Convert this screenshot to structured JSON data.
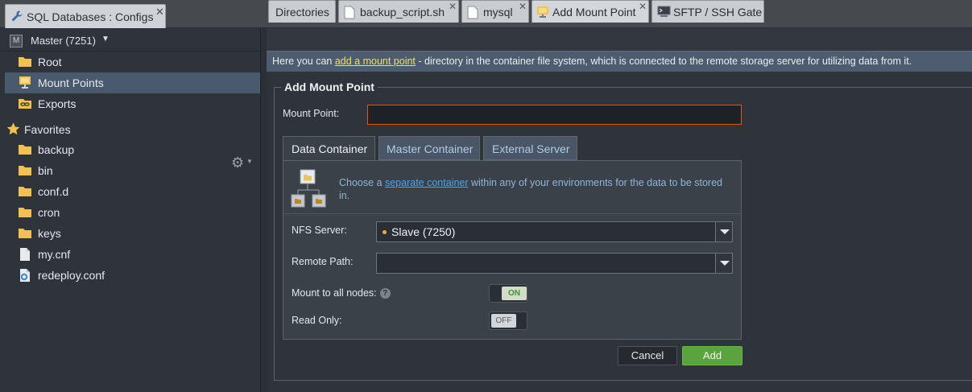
{
  "window": {
    "title": "SQL Databases : Configs"
  },
  "sidebar": {
    "environment": "Master (7251)",
    "env_badge": "M",
    "items": [
      {
        "label": "Root",
        "icon": "folder-icon"
      },
      {
        "label": "Mount Points",
        "icon": "monitor-icon",
        "selected": true
      },
      {
        "label": "Exports",
        "icon": "link-icon"
      }
    ],
    "favorites_label": "Favorites",
    "favorites": [
      {
        "label": "backup",
        "icon": "folder-icon"
      },
      {
        "label": "bin",
        "icon": "folder-icon"
      },
      {
        "label": "conf.d",
        "icon": "folder-icon"
      },
      {
        "label": "cron",
        "icon": "folder-icon"
      },
      {
        "label": "keys",
        "icon": "folder-icon"
      },
      {
        "label": "my.cnf",
        "icon": "file-icon"
      },
      {
        "label": "redeploy.conf",
        "icon": "config-file-icon"
      }
    ]
  },
  "tabs": [
    {
      "label": "Directories"
    },
    {
      "label": "backup_script.sh"
    },
    {
      "label": "mysql"
    },
    {
      "label": "Add Mount Point",
      "active": true
    },
    {
      "label": "SFTP / SSH Gate"
    }
  ],
  "info": {
    "prefix": "Here you can ",
    "link": "add a mount point",
    "suffix": " - directory in the container file system, which is connected to the remote storage server for utilizing data from it."
  },
  "form": {
    "legend": "Add Mount Point",
    "mount_point_label": "Mount Point:",
    "mount_point_value": "",
    "subtabs": [
      {
        "label": "Data Container",
        "active": true
      },
      {
        "label": "Master Container"
      },
      {
        "label": "External Server"
      }
    ],
    "desc_prefix": "Choose a ",
    "desc_link": "separate container",
    "desc_suffix": " within any of your environments for the data to be stored in.",
    "nfs_label": "NFS Server:",
    "nfs_value": "Slave (7250)",
    "remote_path_label": "Remote Path:",
    "remote_path_value": "",
    "mount_all_label": "Mount to all nodes:",
    "mount_all_state": "ON",
    "read_only_label": "Read Only:",
    "read_only_state": "OFF",
    "cancel_label": "Cancel",
    "add_label": "Add"
  },
  "colors": {
    "accent_green": "#5aa33f",
    "selected_row": "#4a5a6e",
    "link": "#4fa3e8",
    "highlight": "#f5e04b"
  }
}
